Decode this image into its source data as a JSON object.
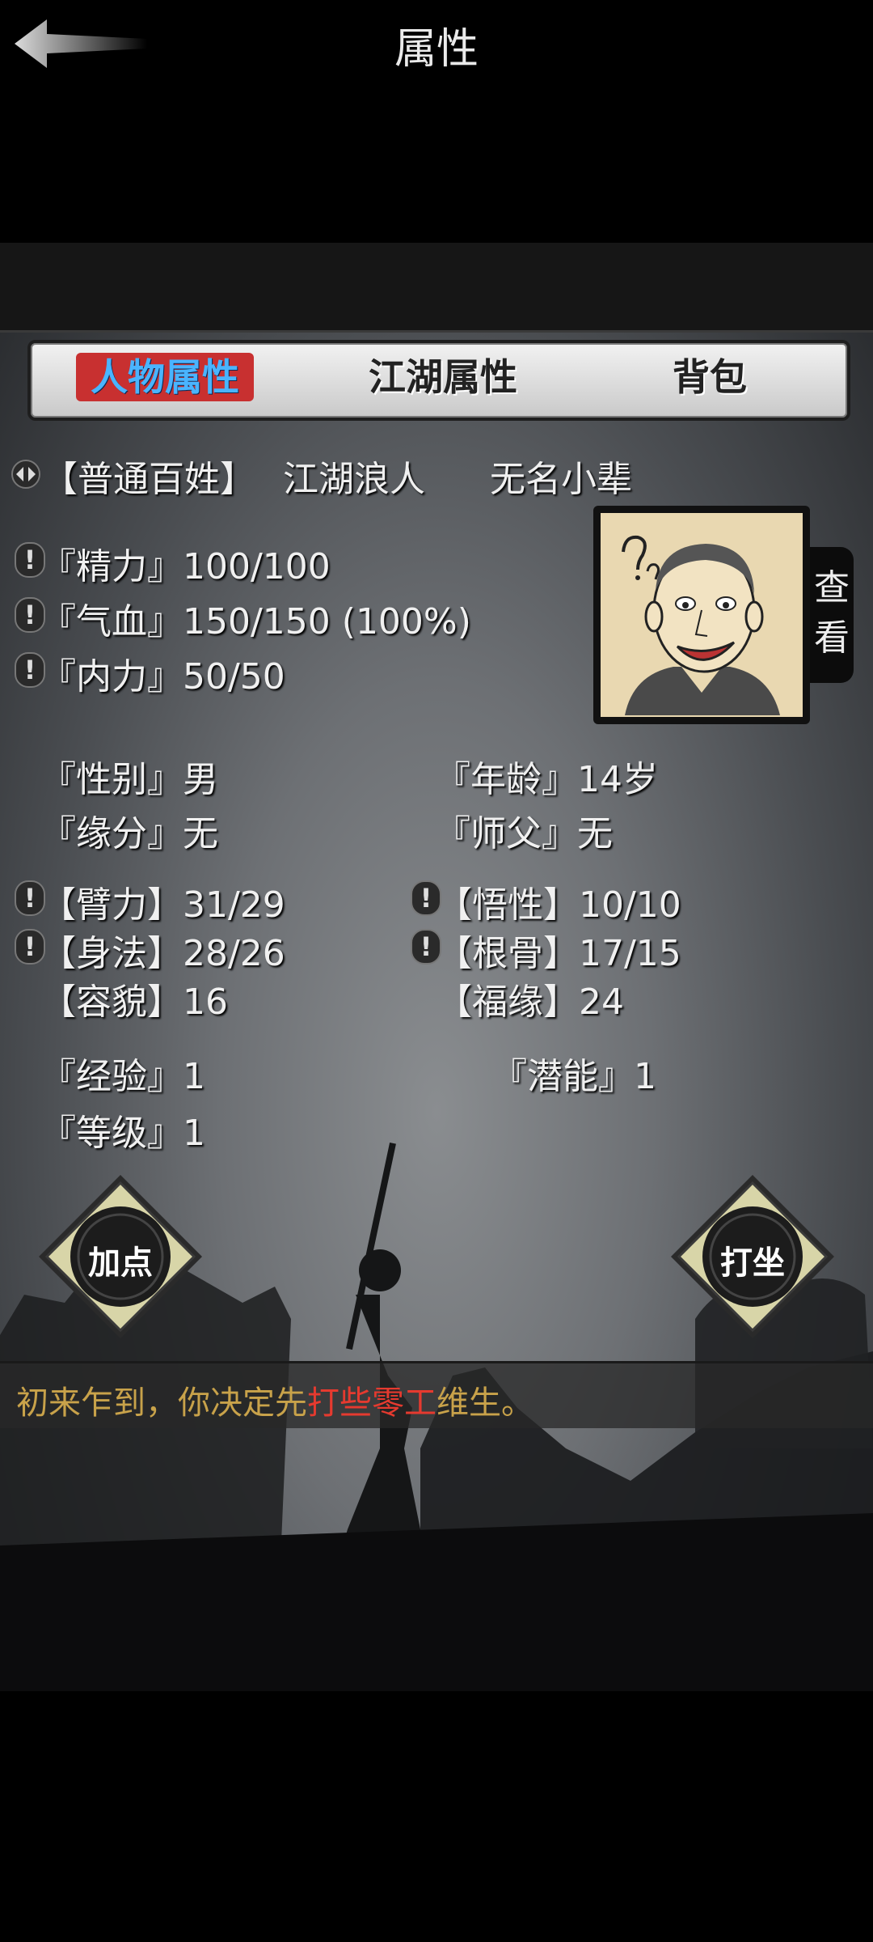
{
  "header": {
    "title": "属性"
  },
  "tabs": [
    {
      "label": "人物属性"
    },
    {
      "label": "江湖属性"
    },
    {
      "label": "背包"
    }
  ],
  "titles": {
    "current": "【普通百姓】",
    "t2": "江湖浪人",
    "t3": "无名小辈"
  },
  "vitals": [
    {
      "label": "『精力』100/100"
    },
    {
      "label": "『气血』150/150 (100%)"
    },
    {
      "label": "『内力』50/50"
    }
  ],
  "portrait": {
    "view_label_1": "查",
    "view_label_2": "看"
  },
  "info": {
    "gender": "『性别』男",
    "age": "『年龄』14岁",
    "fate": "『缘分』无",
    "master": "『师父』无"
  },
  "stats": {
    "strength": "【臂力】31/29",
    "insight": "【悟性】10/10",
    "agility": "【身法】28/26",
    "constitution": "【根骨】17/15",
    "looks": "【容貌】16",
    "fortune": "【福缘】24"
  },
  "progress": {
    "exp": "『经验』1",
    "potential": "『潜能』1",
    "level": "『等级』1"
  },
  "buttons": {
    "add_points": "加点",
    "meditate": "打坐"
  },
  "message": {
    "prefix": "初来乍到，你决定先",
    "highlight": "打些零工",
    "suffix": "维生。"
  },
  "colors": {
    "active_tab_bg": "#c83030",
    "active_tab_text": "#4ab4ff",
    "message_text": "#c8a24a",
    "message_highlight": "#e53a2f"
  },
  "icons": {
    "back": "back-arrow-icon",
    "toggle": "toggle-arrows-icon",
    "alert": "exclamation-icon"
  }
}
